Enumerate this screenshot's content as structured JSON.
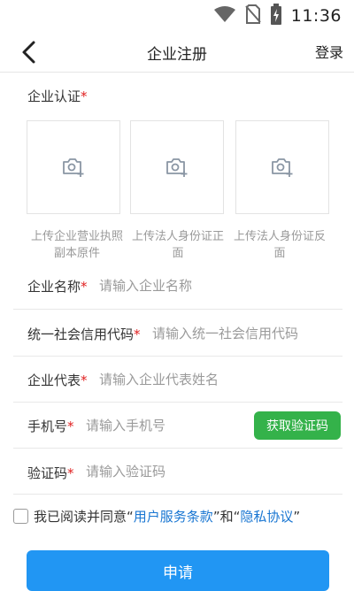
{
  "status_bar": {
    "time": "11:36",
    "icons": [
      "wifi-icon",
      "no-sim-icon",
      "battery-charging-icon"
    ]
  },
  "nav": {
    "title": "企业注册",
    "back_icon": "chevron-left-icon",
    "login_label": "登录"
  },
  "certification": {
    "title": "企业认证",
    "required_mark": "*",
    "uploads": [
      {
        "icon": "camera-add-icon",
        "caption_line1": "上传企业营业执照",
        "caption_line2": "副本原件"
      },
      {
        "icon": "camera-add-icon",
        "caption_line1": "上传法人身份证正",
        "caption_line2": "面"
      },
      {
        "icon": "camera-add-icon",
        "caption_line1": "上传法人身份证反",
        "caption_line2": "面"
      }
    ]
  },
  "form": {
    "company_name": {
      "label": "企业名称",
      "required_mark": "*",
      "placeholder": "请输入企业名称",
      "value": ""
    },
    "credit_code": {
      "label": "统一社会信用代码",
      "required_mark": "*",
      "placeholder": "请输入统一社会信用代码",
      "value": ""
    },
    "representative": {
      "label": "企业代表",
      "required_mark": "*",
      "placeholder": "请输入企业代表姓名",
      "value": ""
    },
    "phone": {
      "label": "手机号",
      "required_mark": "*",
      "placeholder": "请输入手机号",
      "value": ""
    },
    "get_code_label": "获取验证码",
    "verify_code": {
      "label": "验证码",
      "required_mark": "*",
      "placeholder": "请输入验证码",
      "value": ""
    }
  },
  "agreement": {
    "checked": false,
    "prefix": "我已阅读并同意",
    "quote_open": "“",
    "terms_link": "用户服务条款",
    "middle": "”和“",
    "privacy_link": "隐私协议",
    "quote_close": "”"
  },
  "submit_label": "申请",
  "colors": {
    "primary": "#2196f3",
    "code_button": "#34b24a",
    "link": "#1976d2",
    "required": "#e02020"
  }
}
